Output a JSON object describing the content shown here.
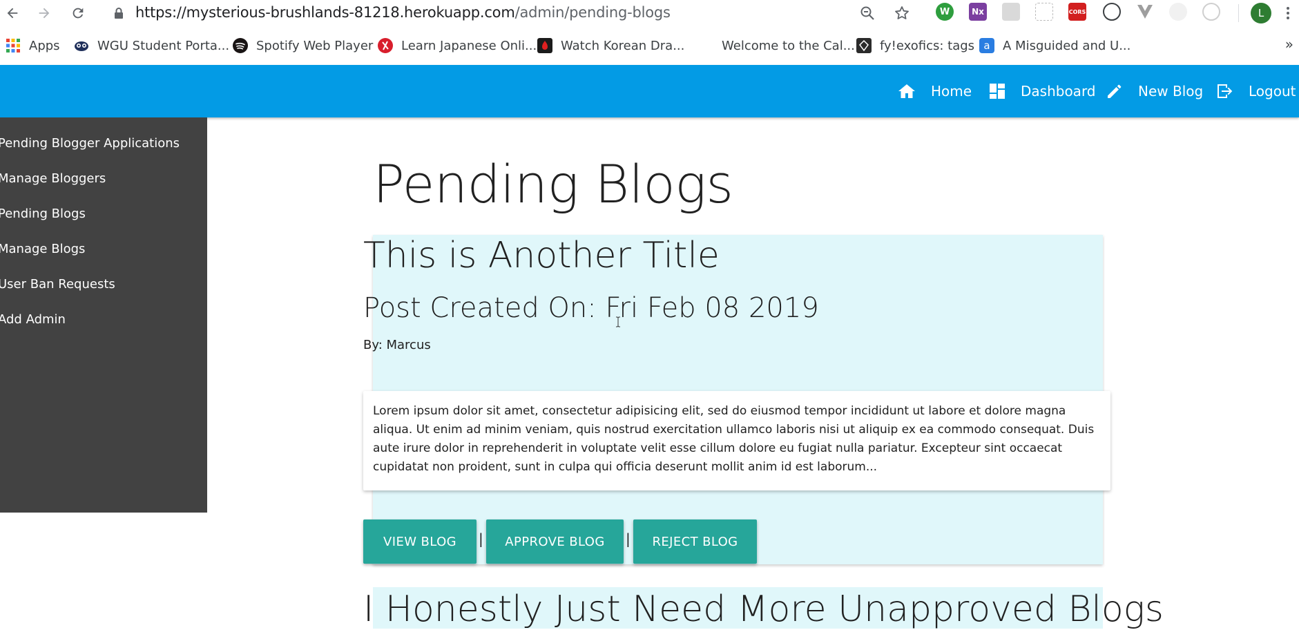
{
  "browser": {
    "url_host": "https://mysterious-brushlands-81218.herokuapp.com",
    "url_path": "/admin/pending-blogs",
    "profile_initial": "L",
    "extensions": [
      {
        "name": "w-extension-icon",
        "label": "W",
        "color": "#2e9e3e"
      },
      {
        "name": "onenote-clipper-icon",
        "label": "Nx",
        "color": "#7b3fa0"
      },
      {
        "name": "cors-icon",
        "label": "CORS",
        "color": "#d21f1f"
      }
    ]
  },
  "bookmarks": [
    {
      "label": "Apps",
      "icon": "apps-grid-icon"
    },
    {
      "label": "WGU Student Porta...",
      "icon": "owl-icon"
    },
    {
      "label": "Spotify Web Player",
      "icon": "spotify-icon"
    },
    {
      "label": "Learn Japanese Onli...",
      "icon": "japanese-site-icon"
    },
    {
      "label": "Watch Korean Dra...",
      "icon": "korean-drama-icon"
    },
    {
      "label": "Welcome to the Cal...",
      "icon": ""
    },
    {
      "label": "fy!exofics: tags",
      "icon": "tumblr-diamond-icon"
    },
    {
      "label": "A Misguided and U...",
      "icon": "ao3-icon"
    }
  ],
  "bookmarks_overflow": "»",
  "nav": {
    "home": "Home",
    "dashboard": "Dashboard",
    "new_blog": "New Blog",
    "logout": "Logout",
    "color": "#039be5"
  },
  "sidebar": {
    "items": [
      "Pending Blogger Applications",
      "Manage Bloggers",
      "Pending Blogs",
      "Manage Blogs",
      "User Ban Requests",
      "Add Admin"
    ]
  },
  "page": {
    "title": "Pending Blogs"
  },
  "blogs": [
    {
      "title": "This is Another Title",
      "date": "Post Created On: Fri Feb 08 2019",
      "author": "By: Marcus",
      "excerpt": "Lorem ipsum dolor sit amet, consectetur adipisicing elit, sed do eiusmod tempor incididunt ut labore et dolore magna aliqua. Ut enim ad minim veniam, quis nostrud exercitation ullamco laboris nisi ut aliquip ex ea commodo consequat. Duis aute irure dolor in reprehenderit in voluptate velit esse cillum dolore eu fugiat nulla pariatur. Excepteur sint occaecat cupidatat non proident, sunt in culpa qui officia deserunt mollit anim id est laborum...",
      "view_label": "VIEW BLOG",
      "approve_label": "APPROVE BLOG",
      "reject_label": "REJECT BLOG",
      "separator": "|"
    },
    {
      "title": "I Honestly Just Need More Unapproved Blogs"
    }
  ],
  "colors": {
    "card_bg": "#e0f7fa",
    "button": "#26a69a",
    "sidebar": "#424242"
  }
}
